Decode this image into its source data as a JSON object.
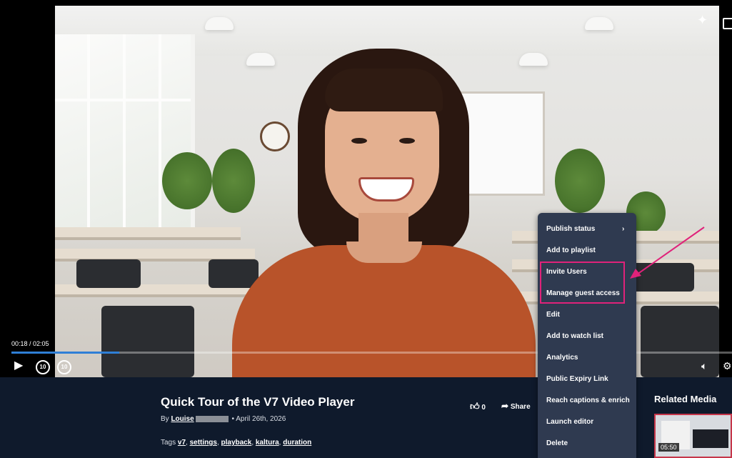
{
  "player": {
    "time": "00:18 / 02:05",
    "progress": 0.15,
    "skip_back": "10",
    "skip_forward": "10"
  },
  "video": {
    "title": "Quick Tour of the V7 Video Player",
    "by_label": "By",
    "author": "Louise",
    "date": "April 26th, 2026",
    "tags_label": "Tags",
    "tags": [
      "v7",
      "settings",
      "playback",
      "kaltura",
      "duration"
    ],
    "likes": "0",
    "share_label": "Share"
  },
  "related": {
    "title": "Related Media",
    "duration": "05:50"
  },
  "menu": {
    "items": [
      "Publish status",
      "Add to playlist",
      "Invite Users",
      "Manage guest access",
      "Edit",
      "Add to watch list",
      "Analytics",
      "Public Expiry Link",
      "Reach captions & enrich",
      "Launch editor",
      "Delete"
    ]
  },
  "colors": {
    "accent": "#2f7fd6",
    "highlight": "#e0227a",
    "menu_bg": "#2f3a50",
    "page_bg": "#0f1a2c"
  }
}
